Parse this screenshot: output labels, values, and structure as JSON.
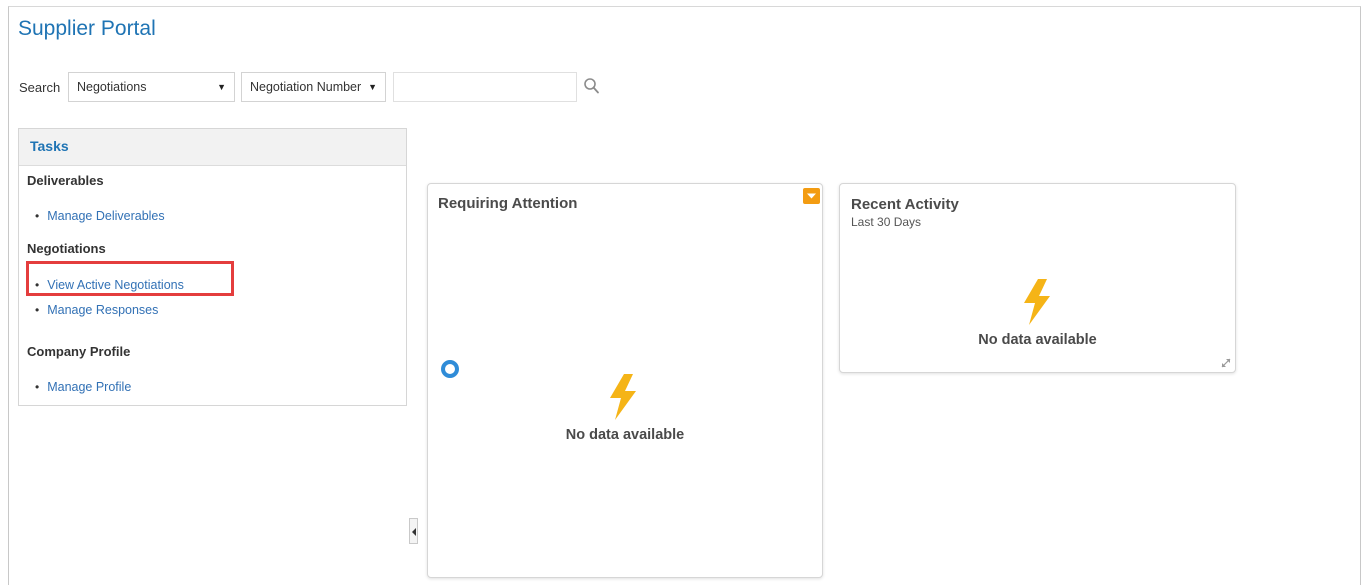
{
  "app": {
    "title": "Supplier Portal"
  },
  "search": {
    "label": "Search",
    "category": "Negotiations",
    "field": "Negotiation Number",
    "query": "",
    "placeholder": ""
  },
  "tasks": {
    "header": "Tasks",
    "groups": [
      {
        "title": "Deliverables",
        "items": [
          {
            "label": "Manage Deliverables"
          }
        ]
      },
      {
        "title": "Negotiations",
        "items": [
          {
            "label": "View Active Negotiations"
          },
          {
            "label": "Manage Responses"
          }
        ]
      },
      {
        "title": "Company Profile",
        "items": [
          {
            "label": "Manage Profile"
          }
        ]
      }
    ]
  },
  "cards": {
    "requiring_attention": {
      "title": "Requiring Attention",
      "empty_text": "No data available"
    },
    "recent_activity": {
      "title": "Recent Activity",
      "subtitle": "Last 30 Days",
      "empty_text": "No data available"
    }
  },
  "icons": {
    "search": "search-icon",
    "bolt": "lightning-bolt-icon",
    "menu": "chevron-down-icon",
    "expand": "expand-icon",
    "spinner": "loading-spinner-icon"
  },
  "colors": {
    "accent": "#1f74b4",
    "link": "#3271b5",
    "highlight": "#e43d3d",
    "orange": "#f39c12",
    "bolt": "#f5b417"
  }
}
